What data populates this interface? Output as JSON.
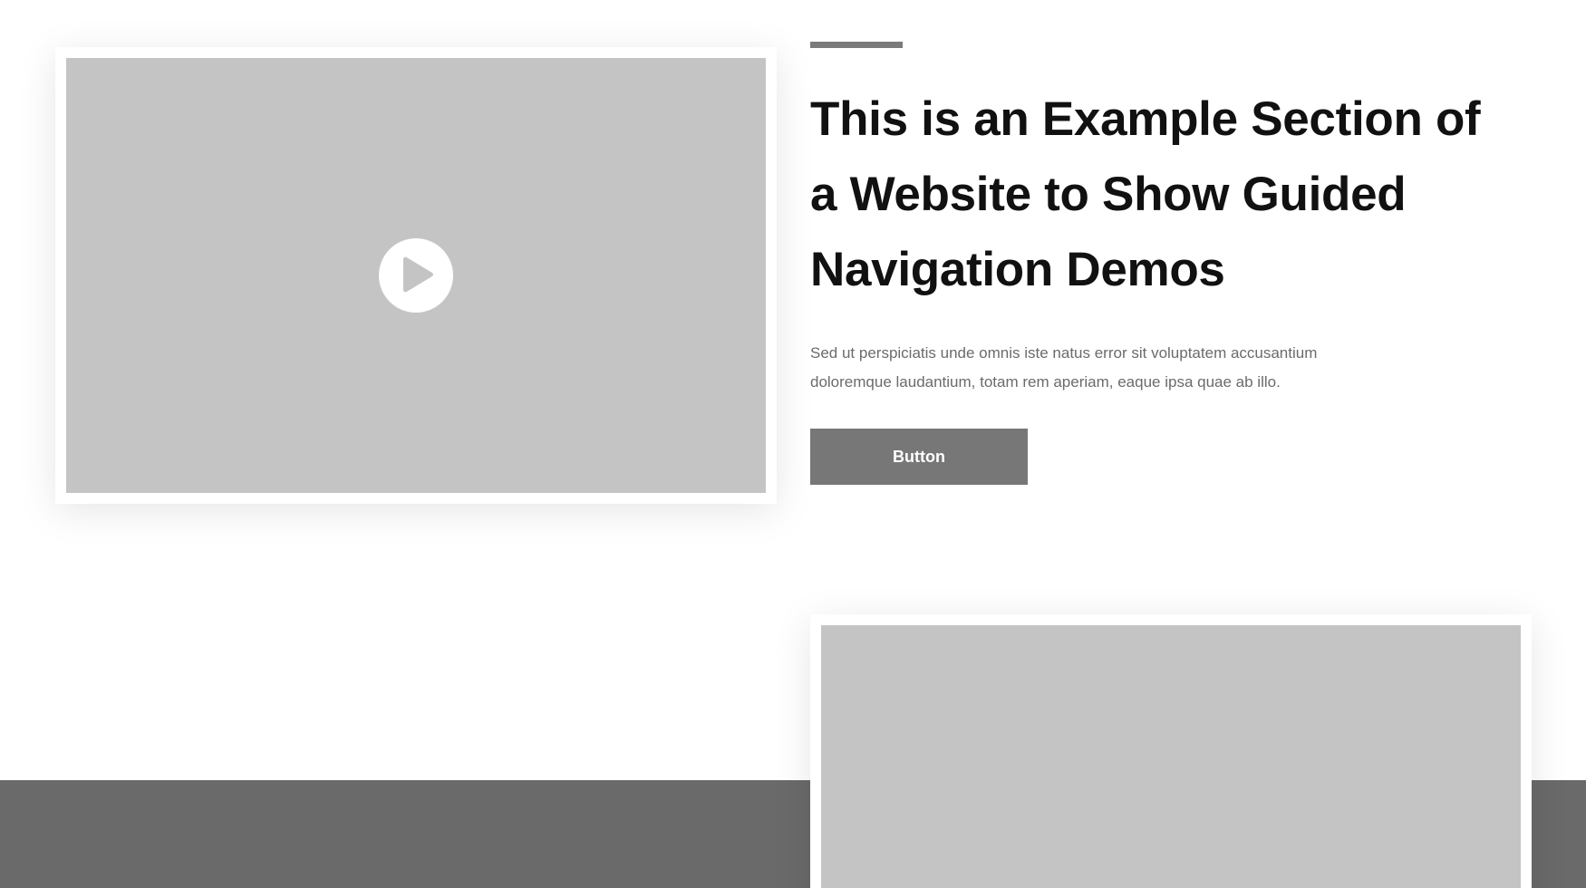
{
  "section": {
    "headline": "This is an Example Section of a Website to Show Guided Navigation Demos",
    "body": "Sed ut perspiciatis unde omnis iste natus error sit voluptatem accusantium doloremque laudantium, totam rem aperiam, eaque ipsa quae ab illo.",
    "button_label": "Button"
  },
  "media": {
    "video_icon": "play-icon",
    "image_placeholder": "image-placeholder"
  },
  "colors": {
    "background": "#ffffff",
    "placeholder": "#c4c4c4",
    "accent_bar": "#7a7a7a",
    "button": "#777777",
    "footer_band": "#6a6a6a",
    "heading": "#111111",
    "body_text": "#6b6b6b"
  }
}
